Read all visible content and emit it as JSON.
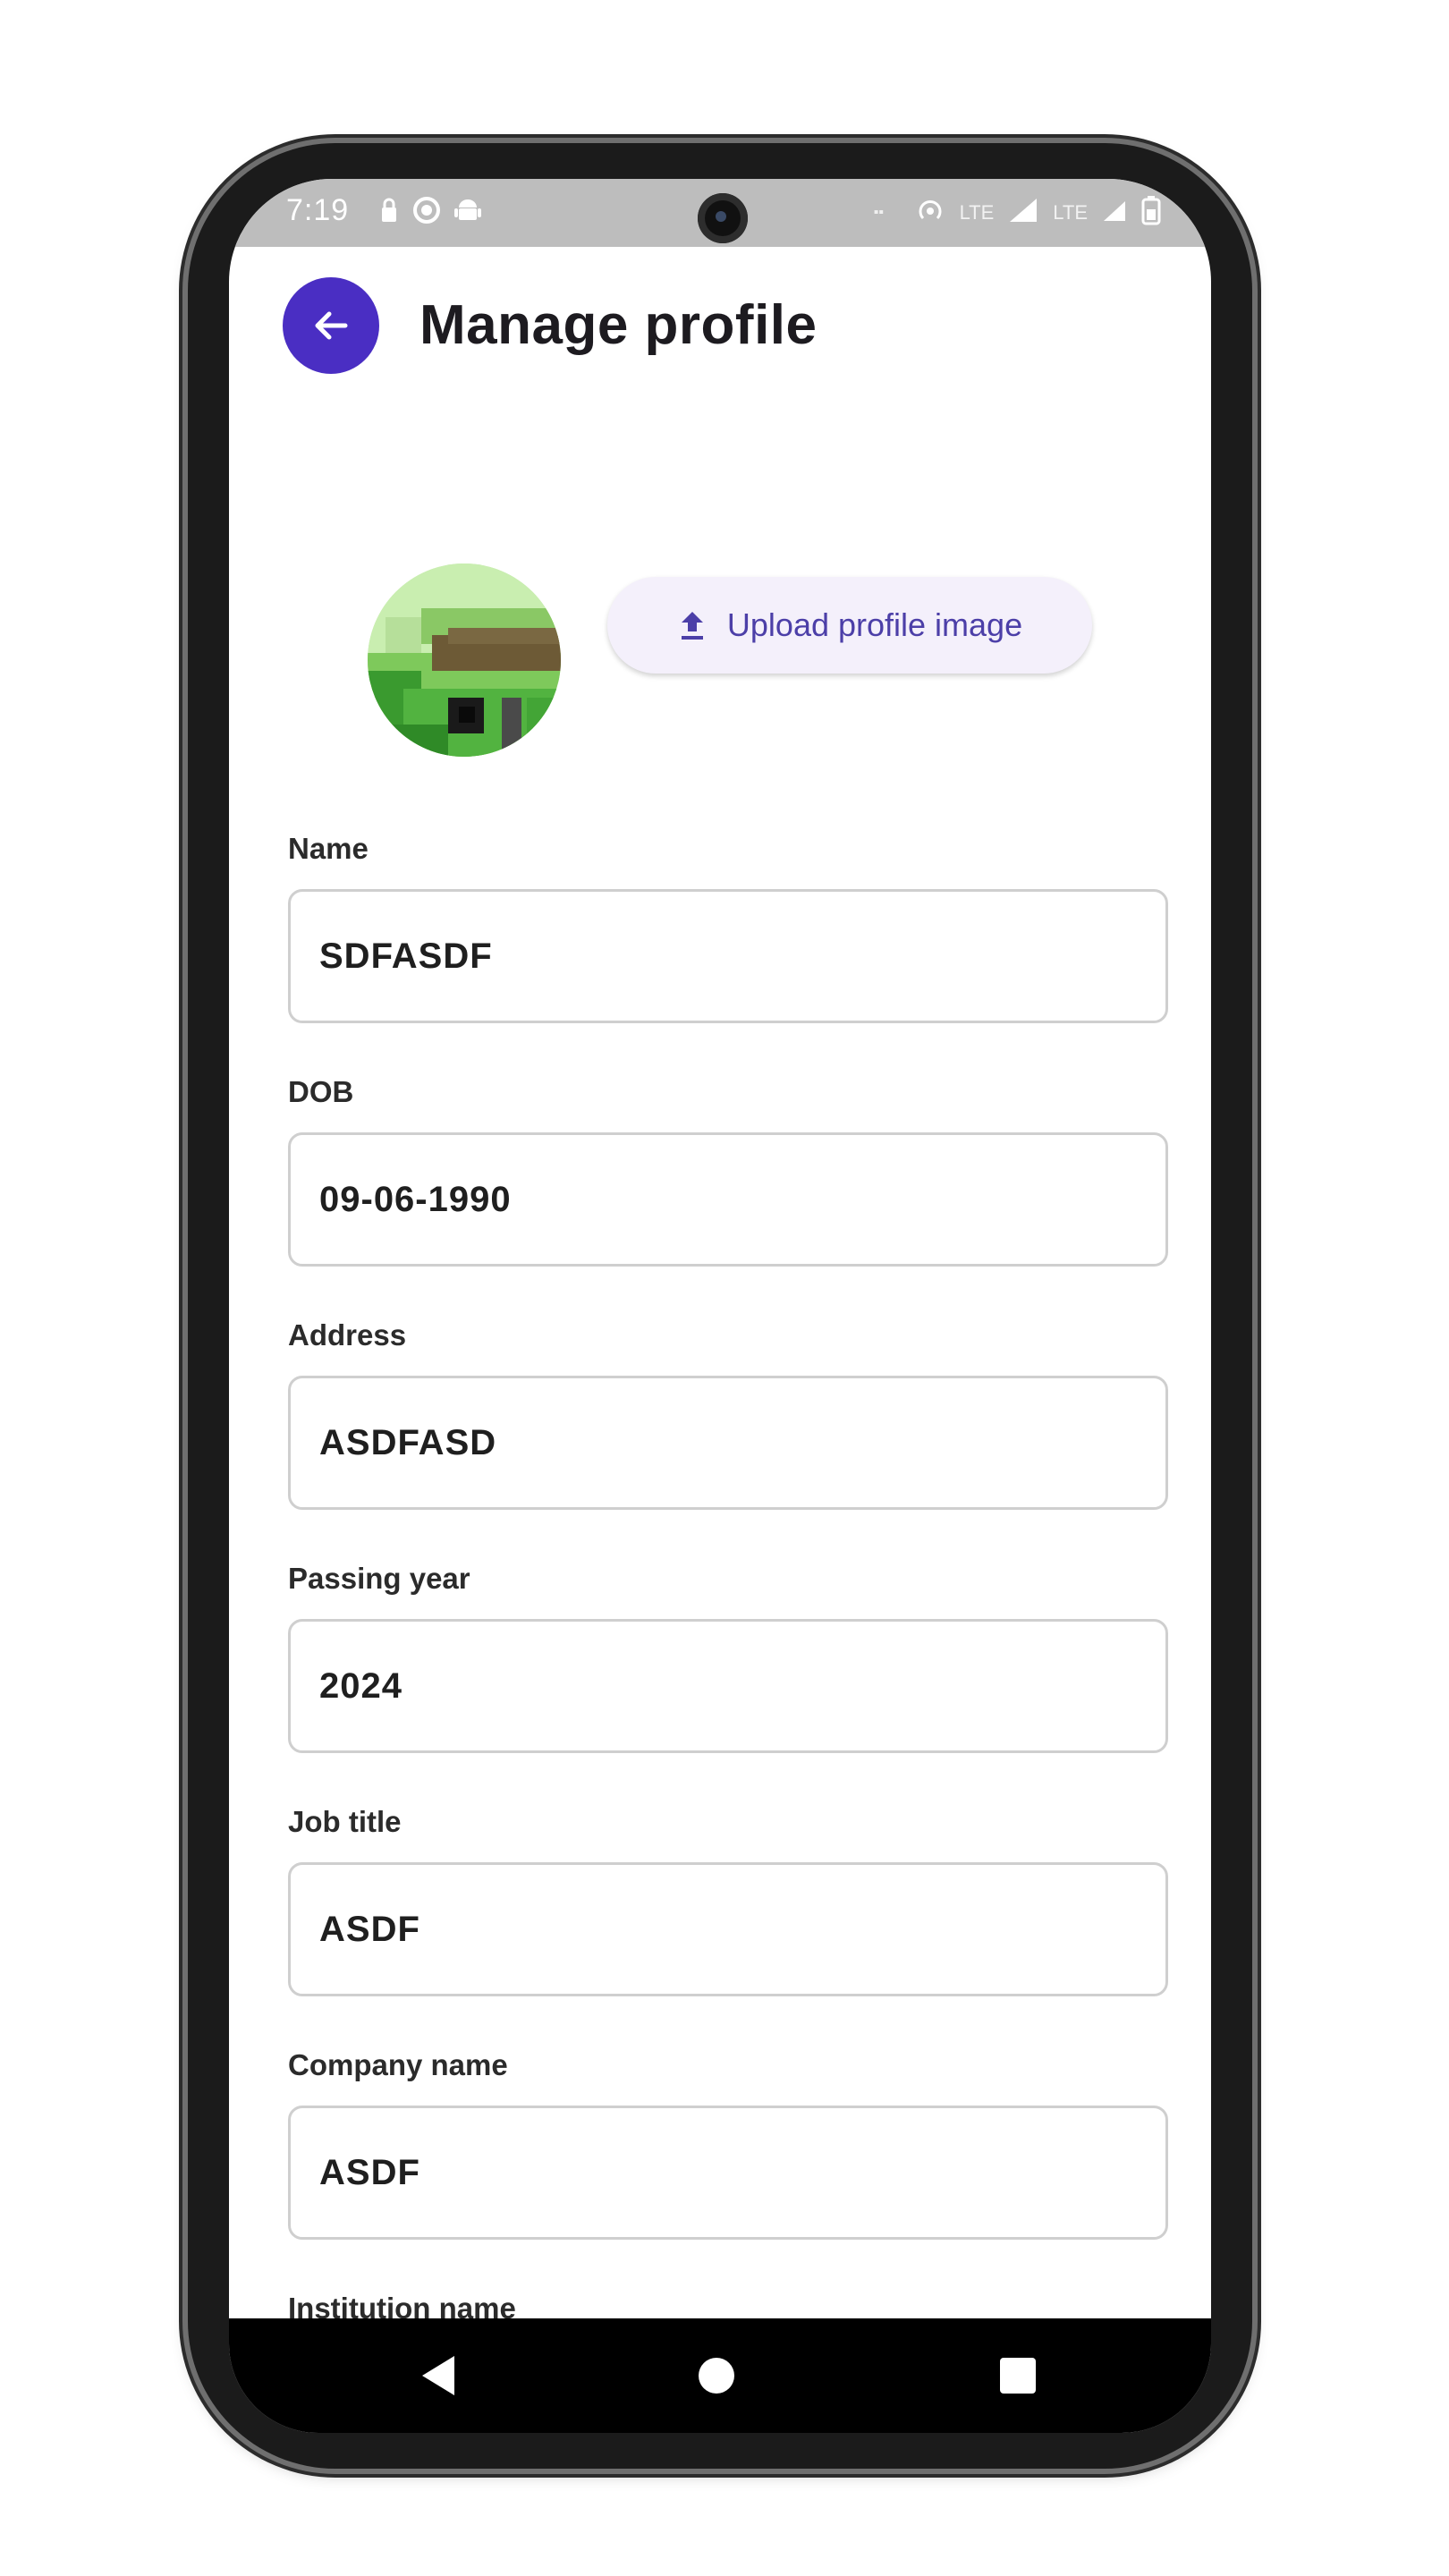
{
  "status_bar": {
    "time": "7:19",
    "left_icons": [
      "lock-icon",
      "whatsapp-icon",
      "android-icon"
    ],
    "right_icons": [
      "volte-icon",
      "hotspot-icon",
      "lte-icon",
      "signal-icon",
      "signal-icon",
      "battery-icon"
    ],
    "right_labels": [
      "LTE",
      "LTE"
    ]
  },
  "app_bar": {
    "title": "Manage profile"
  },
  "profile": {
    "upload_label": "Upload profile image"
  },
  "form": {
    "fields": [
      {
        "label": "Name",
        "value": "SDFASDF"
      },
      {
        "label": "DOB",
        "value": "09-06-1990"
      },
      {
        "label": "Address",
        "value": "ASDFASD"
      },
      {
        "label": "Passing year",
        "value": "2024"
      },
      {
        "label": "Job title",
        "value": "ASDF"
      },
      {
        "label": "Company name",
        "value": "ASDF"
      }
    ],
    "next_label": "Institution name"
  },
  "colors": {
    "accent": "#4a2ec3",
    "upload_text": "#4c3fa8",
    "upload_bg": "#f4f0fb",
    "status_bar_bg": "#bdbdbd"
  }
}
